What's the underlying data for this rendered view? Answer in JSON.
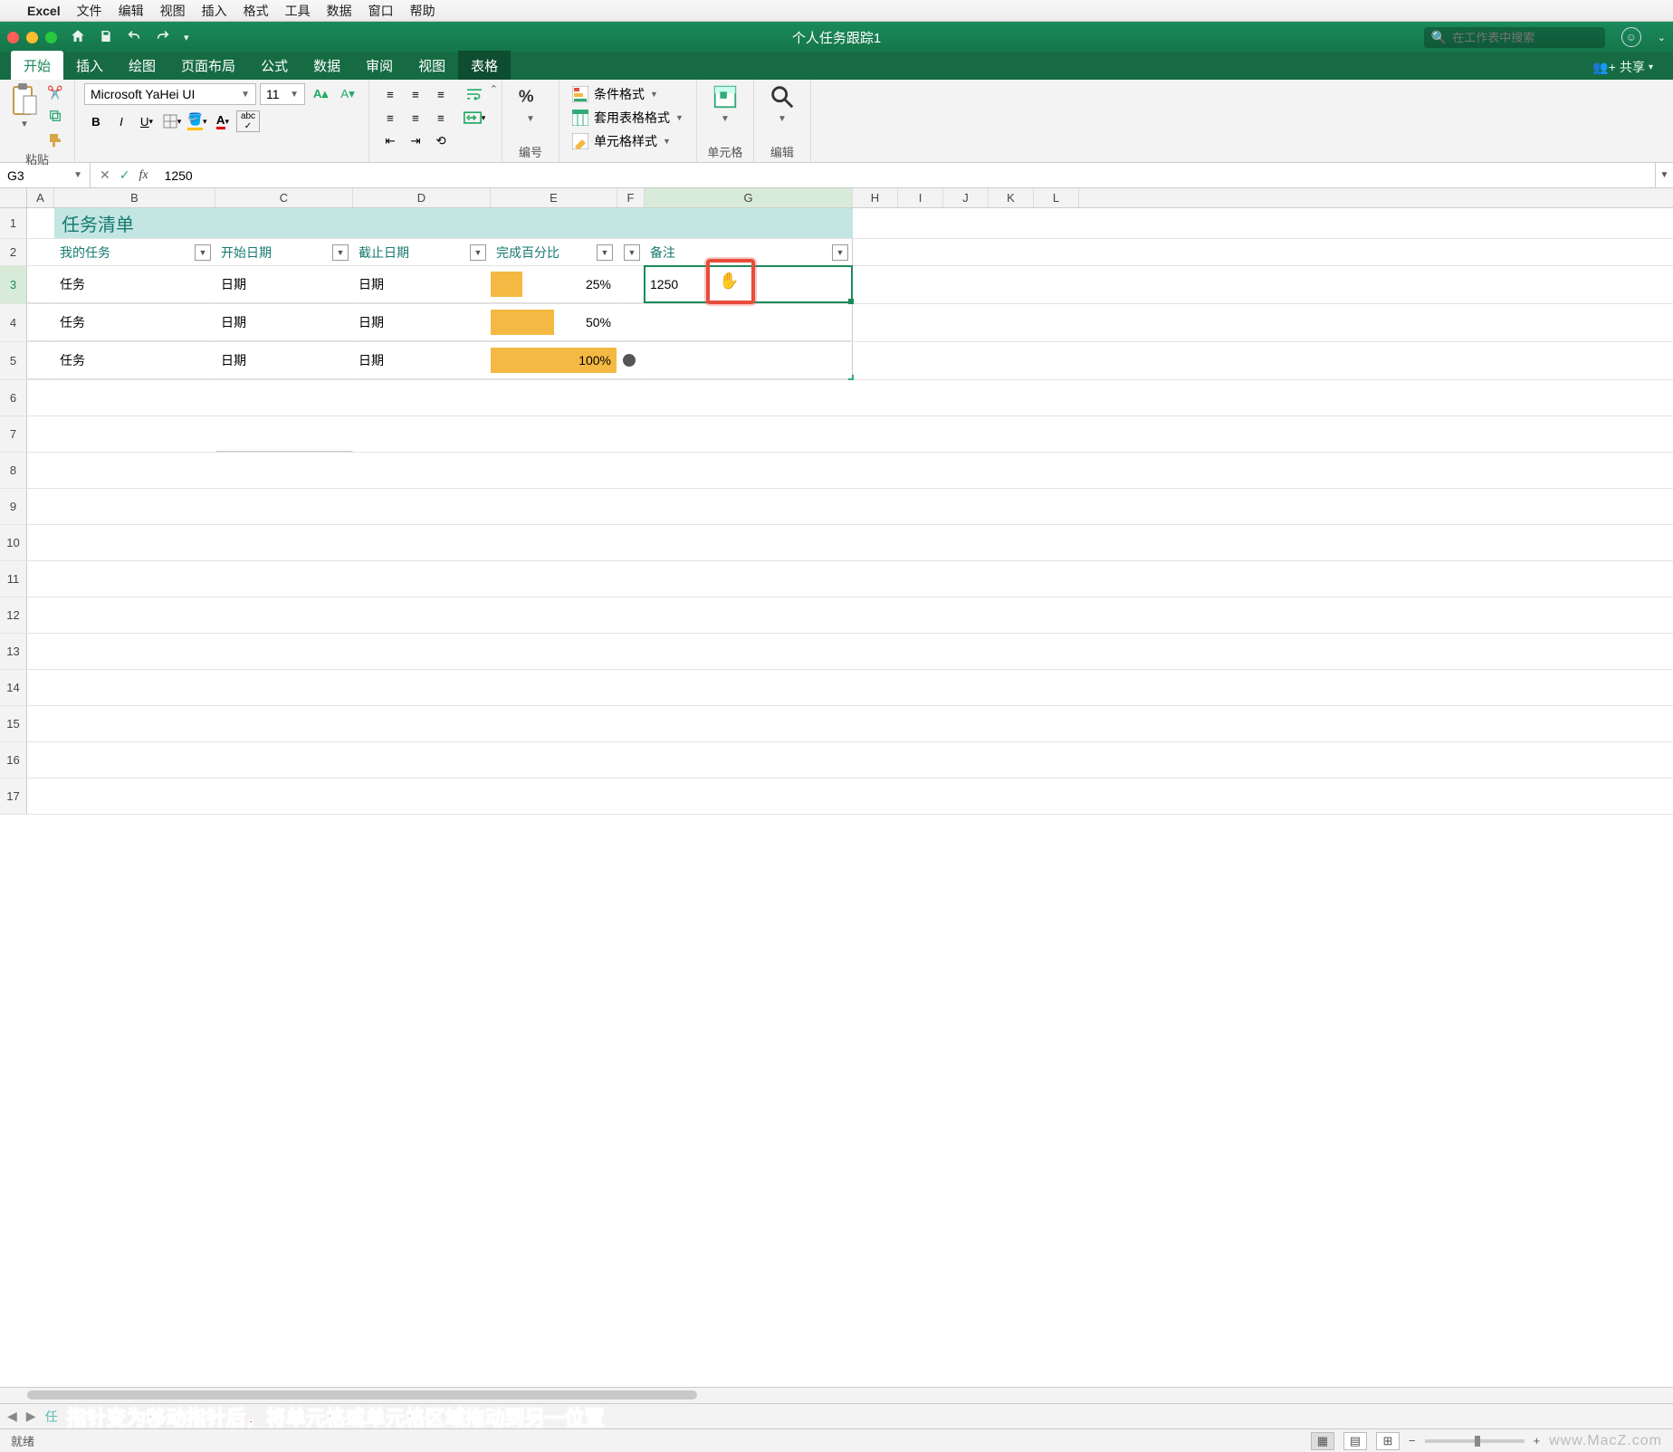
{
  "menubar": {
    "app": "Excel",
    "items": [
      "文件",
      "编辑",
      "视图",
      "插入",
      "格式",
      "工具",
      "数据",
      "窗口",
      "帮助"
    ]
  },
  "titlebar": {
    "doc": "个人任务跟踪1",
    "search_placeholder": "在工作表中搜索"
  },
  "tabs": {
    "items": [
      "开始",
      "插入",
      "绘图",
      "页面布局",
      "公式",
      "数据",
      "审阅",
      "视图",
      "表格"
    ],
    "active": 0,
    "highlighted": 8,
    "share": "共享"
  },
  "ribbon": {
    "paste": "粘贴",
    "font_name": "Microsoft YaHei UI",
    "font_size": "11",
    "number_group": "编号",
    "cond_fmt": "条件格式",
    "table_fmt": "套用表格格式",
    "cell_styles": "单元格样式",
    "cells_group": "单元格",
    "edit_group": "编辑"
  },
  "formula": {
    "name": "G3",
    "value": "1250"
  },
  "columns": [
    "A",
    "B",
    "C",
    "D",
    "E",
    "F",
    "G",
    "H",
    "I",
    "J",
    "K",
    "L"
  ],
  "sheet": {
    "title": "任务清单",
    "headers": {
      "b": "我的任务",
      "c": "开始日期",
      "d": "截止日期",
      "e": "完成百分比",
      "g": "备注"
    },
    "rows": [
      {
        "b": "任务",
        "c": "日期",
        "d": "日期",
        "pct": "25%",
        "bar": 25,
        "g": "1250"
      },
      {
        "b": "任务",
        "c": "日期",
        "d": "日期",
        "pct": "50%",
        "bar": 50,
        "g": ""
      },
      {
        "b": "任务",
        "c": "日期",
        "d": "日期",
        "pct": "100%",
        "bar": 100,
        "g": "",
        "dot": true
      }
    ]
  },
  "annotation": "指针变为移动指针后，将单元格或单元格区域拖动到另一位置",
  "status": {
    "ready": "就绪",
    "zoom": "100%"
  },
  "watermark": "www.MacZ.com"
}
